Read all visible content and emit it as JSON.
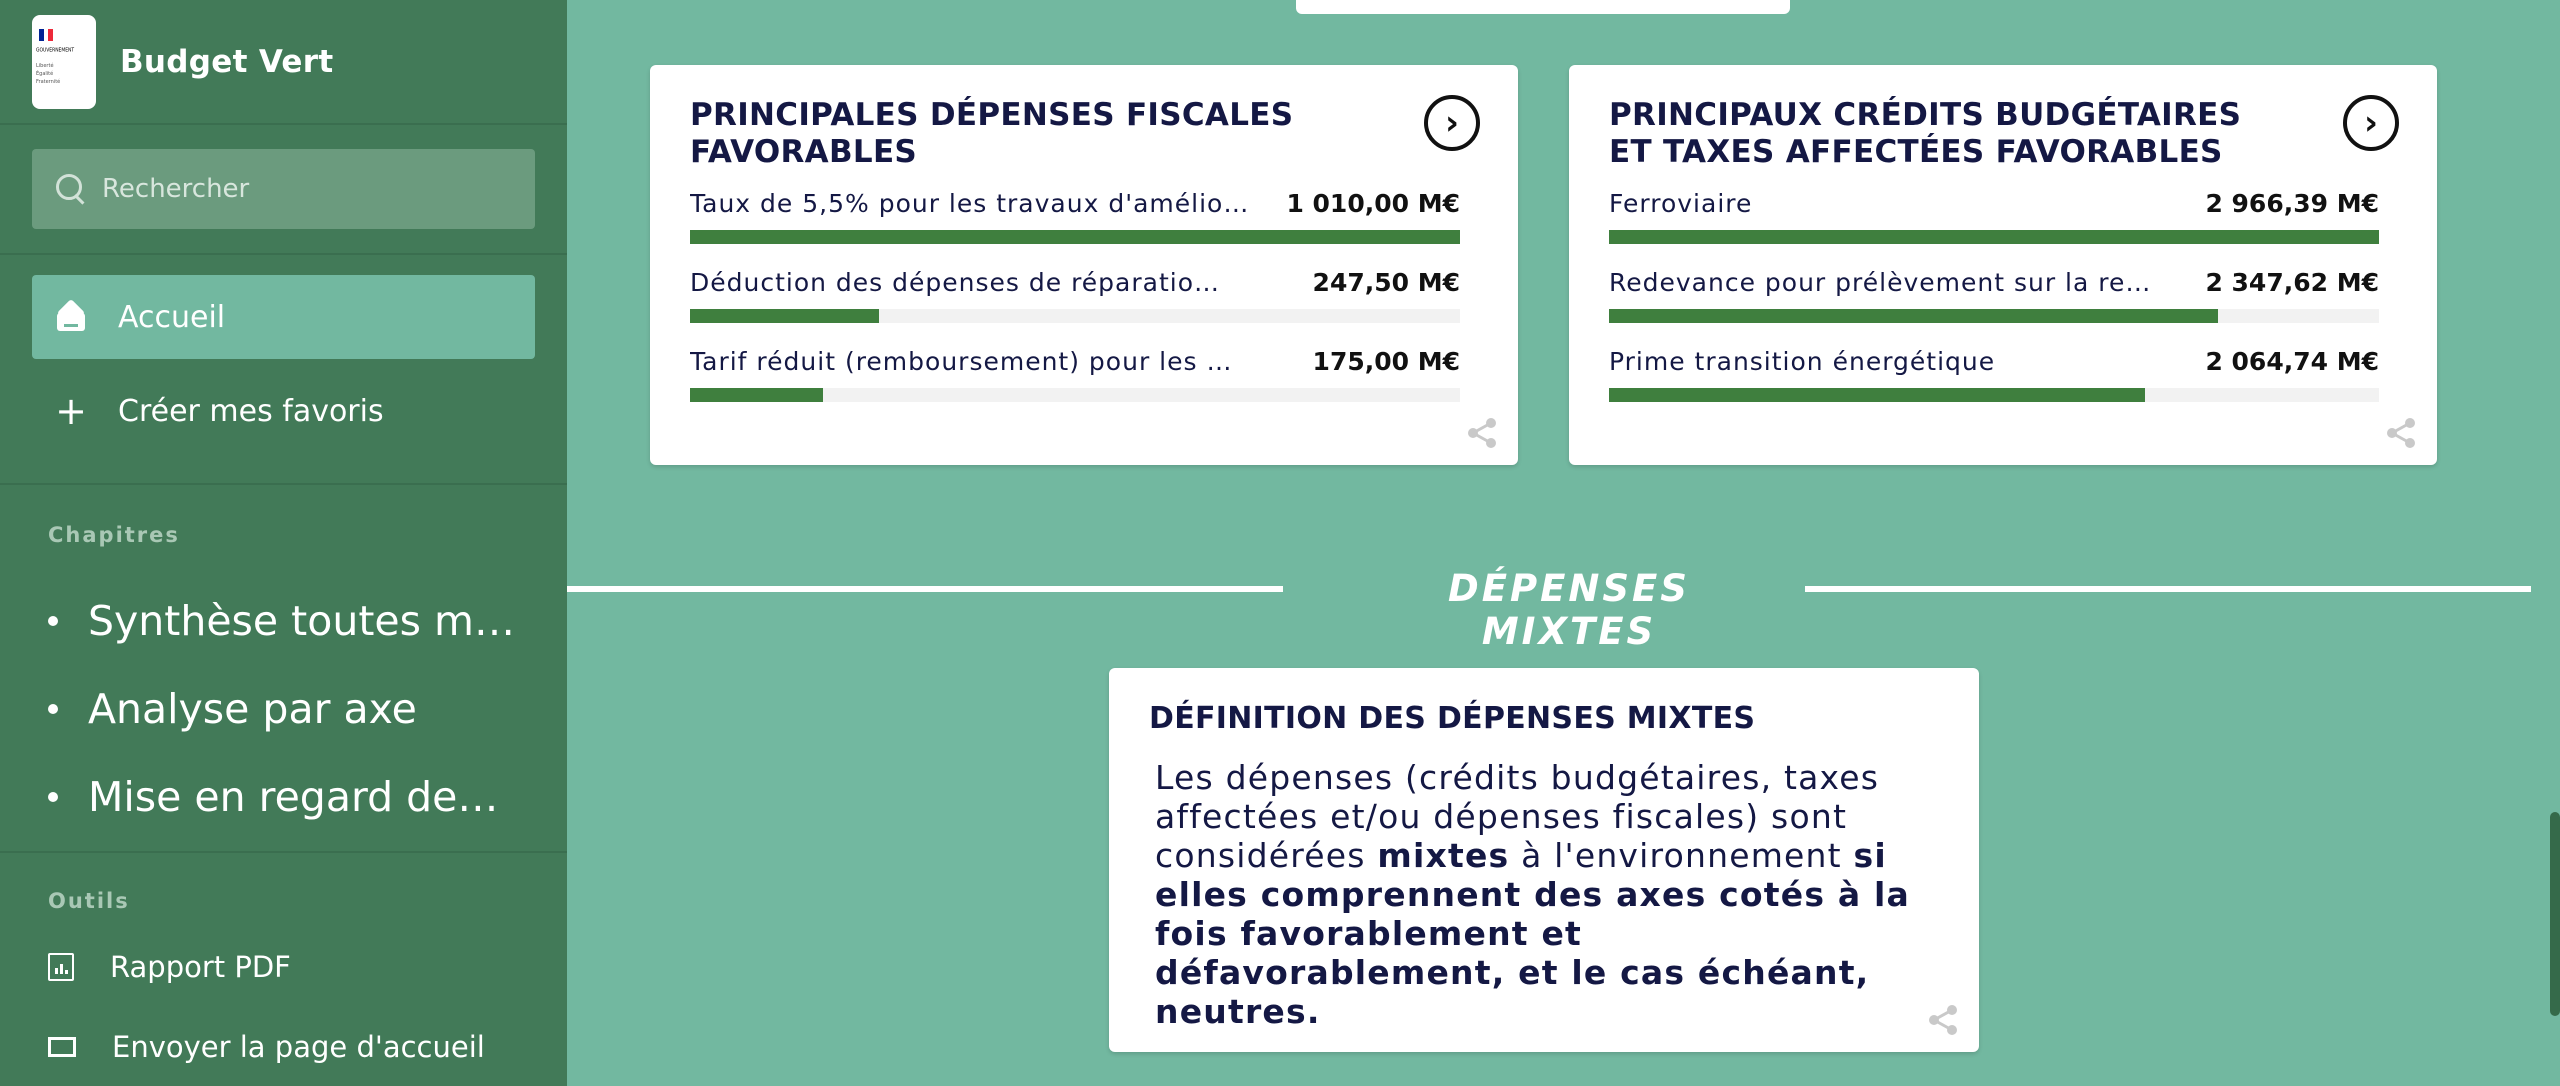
{
  "app": {
    "title": "Budget Vert",
    "logo": {
      "flag_colors": [
        "#002395",
        "#ffffff",
        "#ed2939"
      ],
      "gov_text": "GOUVERNEMENT",
      "motto": "Liberté Égalité Fraternité"
    }
  },
  "sidebar": {
    "search": {
      "placeholder": "Rechercher"
    },
    "nav": [
      {
        "label": "Accueil",
        "icon": "home-icon",
        "active": true
      },
      {
        "label": "Créer mes favoris",
        "icon": "plus-icon",
        "active": false
      }
    ],
    "chapters_label": "Chapitres",
    "chapters": [
      {
        "label": "Synthèse toutes mi…"
      },
      {
        "label": "Analyse par axe"
      },
      {
        "label": "Mise en regard des …"
      }
    ],
    "tools_label": "Outils",
    "tools": [
      {
        "label": "Rapport PDF",
        "icon": "pdf-report-icon"
      },
      {
        "label": "Envoyer la page d'accueil",
        "icon": "send-mail-icon"
      }
    ]
  },
  "cards": {
    "fiscal": {
      "title": "PRINCIPALES DÉPENSES FISCALES FAVORABLES",
      "rows": [
        {
          "label": "Taux de 5,5% pour les travaux d'amélio…",
          "value": "1 010,00 M€",
          "share": 1.0
        },
        {
          "label": "Déduction des dépenses de réparatio…",
          "value": "247,50 M€",
          "share": 0.245
        },
        {
          "label": "Tarif réduit (remboursement) pour les …",
          "value": "175,00 M€",
          "share": 0.173
        }
      ]
    },
    "credits": {
      "title": "PRINCIPAUX CRÉDITS BUDGÉTAIRES ET TAXES AFFECTÉES FAVORABLES",
      "rows": [
        {
          "label": "Ferroviaire",
          "value": "2 966,39 M€",
          "share": 1.0
        },
        {
          "label": "Redevance pour prélèvement sur la re…",
          "value": "2 347,62 M€",
          "share": 0.791
        },
        {
          "label": "Prime transition énergétique",
          "value": "2 064,74 M€",
          "share": 0.696
        }
      ]
    }
  },
  "mixed": {
    "section_title": "DÉPENSES MIXTES",
    "card_title": "DÉFINITION DES DÉPENSES MIXTES",
    "text_1": "Les dépenses (crédits budgétaires, taxes affectées et/ou dépenses fiscales) sont considérées ",
    "text_bold_1": "mixtes",
    "text_2": " à l'environnement ",
    "text_bold_2": "si elles comprennent des axes cotés à la fois favorablement et défavorablement, et le cas échéant, neutres."
  },
  "colors": {
    "sidebar": "#427a58",
    "background": "#72b8a0",
    "bar": "#3f7f3e",
    "title_text": "#141844"
  }
}
